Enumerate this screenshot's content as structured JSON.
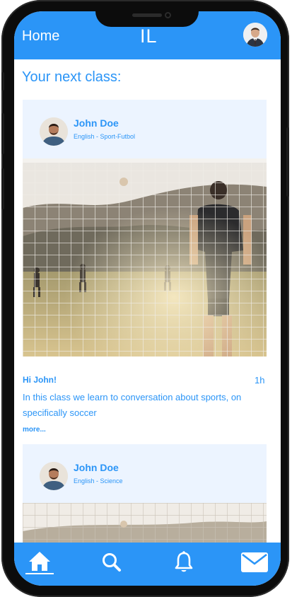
{
  "header": {
    "title": "Home",
    "logo": "IL"
  },
  "main": {
    "section_title": "Your next class:",
    "cards": [
      {
        "teacher_name": "John Doe",
        "subject": "English - Sport-Futbol",
        "greeting": "Hi John!",
        "duration": "1h",
        "description": "In this class we learn to conversation about sports, on specifically soccer",
        "more_label": "more..."
      },
      {
        "teacher_name": "John Doe",
        "subject": "English - Science"
      }
    ]
  },
  "bottom_nav": {
    "items": [
      {
        "icon": "home-icon",
        "active": true
      },
      {
        "icon": "search-icon",
        "active": false
      },
      {
        "icon": "bell-icon",
        "active": false
      },
      {
        "icon": "mail-icon",
        "active": false
      }
    ]
  },
  "colors": {
    "primary": "#2b95f7",
    "card_header_bg": "#ecf4ff",
    "phone_frame": "#0c0c0c"
  }
}
